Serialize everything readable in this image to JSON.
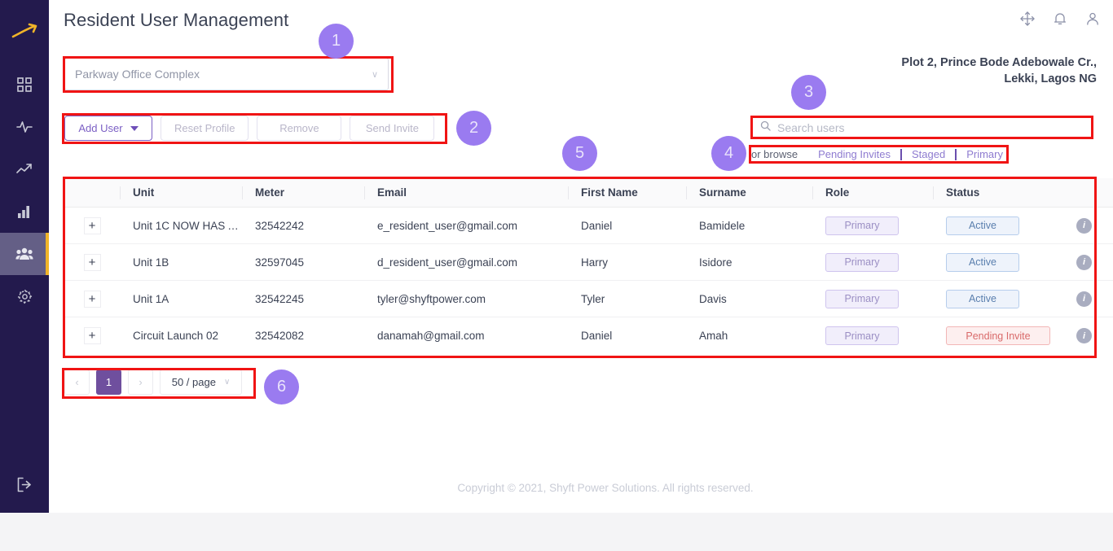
{
  "header": {
    "title": "Resident User Management",
    "icons": [
      "move-icon",
      "bell-icon",
      "user-icon"
    ]
  },
  "sidebar": {
    "logo": "arrow-logo",
    "items": [
      {
        "name": "dashboard",
        "icon": "grid-icon",
        "active": false
      },
      {
        "name": "activity",
        "icon": "pulse-icon",
        "active": false
      },
      {
        "name": "trends",
        "icon": "trending-up-icon",
        "active": false
      },
      {
        "name": "reports",
        "icon": "bar-chart-icon",
        "active": false
      },
      {
        "name": "users",
        "icon": "users-icon",
        "active": true
      },
      {
        "name": "settings",
        "icon": "gear-icon",
        "active": false
      }
    ],
    "logout": {
      "name": "logout",
      "icon": "logout-icon"
    }
  },
  "site_select": {
    "value": "Parkway Office Complex",
    "caret": "∨"
  },
  "address": {
    "line1": "Plot 2, Prince Bode Adebowale Cr.,",
    "line2": "Lekki, Lagos NG"
  },
  "toolbar": {
    "add_user": "Add User",
    "reset_profile": "Reset Profile",
    "remove": "Remove",
    "send_invite": "Send Invite"
  },
  "search": {
    "placeholder": "Search users",
    "value": "",
    "icon": "search-icon"
  },
  "browse": {
    "label": "or browse",
    "links": [
      "Pending Invites",
      "Staged",
      "Primary"
    ]
  },
  "table": {
    "columns": [
      "Unit",
      "Meter",
      "Email",
      "First Name",
      "Surname",
      "Role",
      "Status"
    ],
    "rows": [
      {
        "expand": "+",
        "unit": "Unit 1C NOW HAS A …",
        "meter": "32542242",
        "email": "e_resident_user@gmail.com",
        "first_name": "Daniel",
        "surname": "Bamidele",
        "role": "Primary",
        "status": "Active",
        "status_type": "active",
        "info": "i"
      },
      {
        "expand": "+",
        "unit": "Unit 1B",
        "meter": "32597045",
        "email": "d_resident_user@gmail.com",
        "first_name": "Harry",
        "surname": "Isidore",
        "role": "Primary",
        "status": "Active",
        "status_type": "active",
        "info": "i"
      },
      {
        "expand": "+",
        "unit": "Unit 1A",
        "meter": "32542245",
        "email": "tyler@shyftpower.com",
        "first_name": "Tyler",
        "surname": "Davis",
        "role": "Primary",
        "status": "Active",
        "status_type": "active",
        "info": "i"
      },
      {
        "expand": "+",
        "unit": "Circuit Launch 02",
        "meter": "32542082",
        "email": "danamah@gmail.com",
        "first_name": "Daniel",
        "surname": "Amah",
        "role": "Primary",
        "status": "Pending Invite",
        "status_type": "pending",
        "info": "i"
      }
    ]
  },
  "pagination": {
    "prev": "‹",
    "page": "1",
    "next": "›",
    "page_size": "50 / page",
    "caret": "∨"
  },
  "footer": {
    "copyright": "Copyright © 2021, Shyft Power Solutions. All rights reserved."
  },
  "annotations": {
    "accent_color": "#9a7bf0",
    "box_color": "#f01414",
    "markers": [
      "1",
      "2",
      "3",
      "4",
      "5",
      "6"
    ]
  }
}
